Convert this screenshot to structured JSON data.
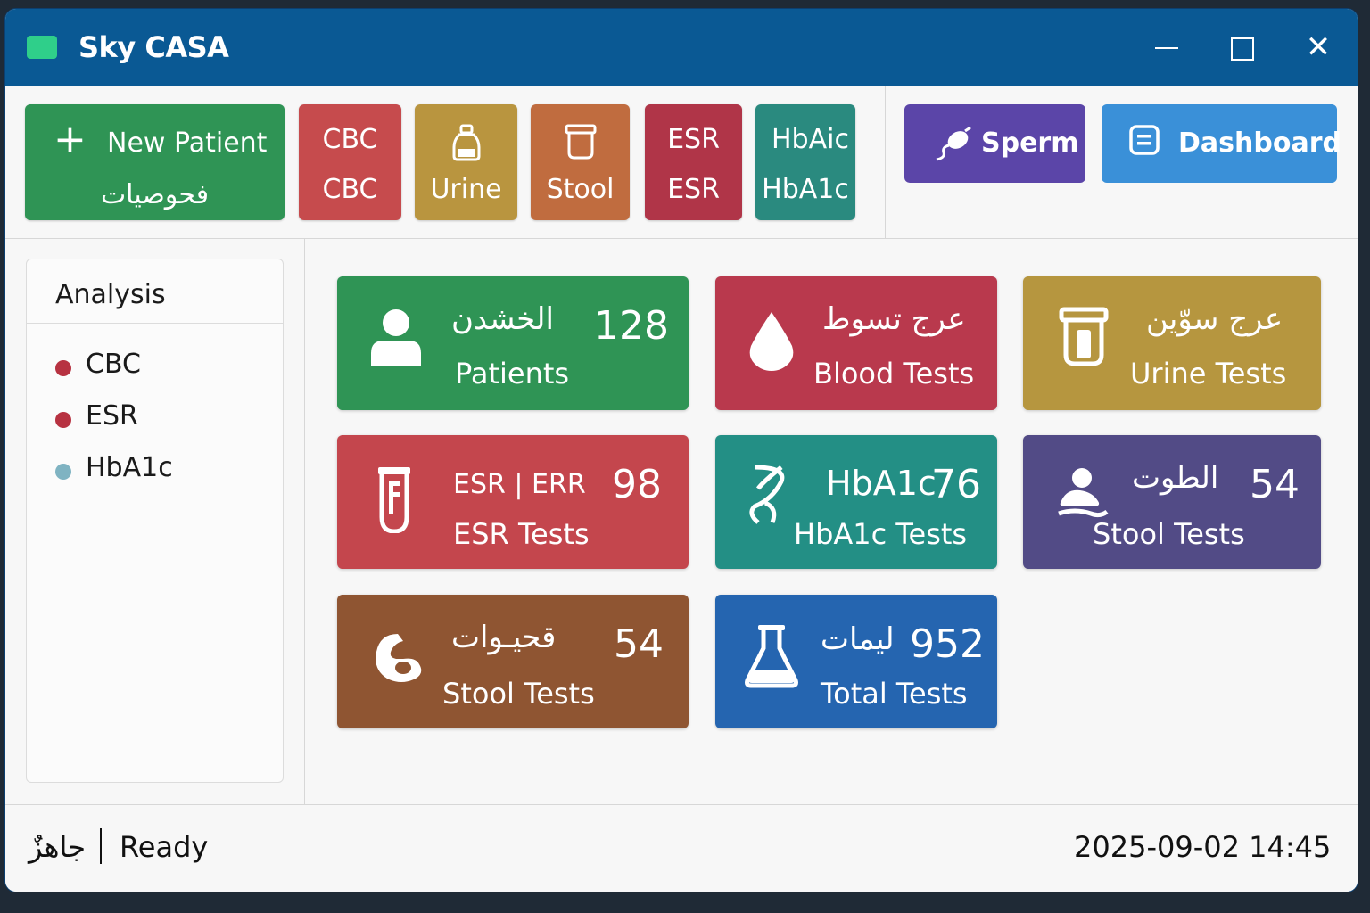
{
  "window": {
    "title": "Sky CASA"
  },
  "toolbar": {
    "new_patient": {
      "label": "New Patient",
      "sub": "فحوصيات"
    },
    "cbc": {
      "l1": "CBC",
      "l2": "CBC"
    },
    "urine": {
      "l2": "Urine"
    },
    "stool": {
      "l2": "Stool"
    },
    "esr": {
      "l1": "ESR",
      "l2": "ESR"
    },
    "hba": {
      "l1": "HbAic",
      "l2": "HbA1c"
    },
    "sperm": {
      "label": "Sperm"
    },
    "dashboard": {
      "label": "Dashboard"
    }
  },
  "sidebar": {
    "title": "Analysis",
    "items": [
      {
        "label": "CBC",
        "color": "#b73241"
      },
      {
        "label": "ESR",
        "color": "#b73241"
      },
      {
        "label": "HbA1c",
        "color": "#7fb3c2"
      }
    ]
  },
  "cards": {
    "patients": {
      "ar": "الخشدن",
      "num": "128",
      "sub": "Patients",
      "color": "#2f9455"
    },
    "blood": {
      "ar": "عرج تسوط",
      "sub": "Blood Tests",
      "color": "#b9394d"
    },
    "urine": {
      "ar": "عرج سوّين",
      "sub": "Urine Tests",
      "color": "#b6963f"
    },
    "esr": {
      "ar": "ESR | ERR",
      "num": "98",
      "sub": "ESR Tests",
      "color": "#c4464d"
    },
    "hba": {
      "ar": "HbA1c",
      "num": "76",
      "sub": "HbA1c Tests",
      "color": "#238f85"
    },
    "stool_purple": {
      "ar": "الطوت",
      "num": "54",
      "sub": "Stool Tests",
      "color": "#524b86"
    },
    "stool_brown": {
      "ar": "قحيـوات",
      "num": "54",
      "sub": "Stool Tests",
      "color": "#8f5532"
    },
    "total": {
      "ar": "ليمات",
      "num": "952",
      "sub": "Total Tests",
      "color": "#2565b0"
    }
  },
  "status": {
    "ar": "جاهزٌ",
    "ready": "Ready",
    "datetime": "2025-09-02 14:45"
  }
}
